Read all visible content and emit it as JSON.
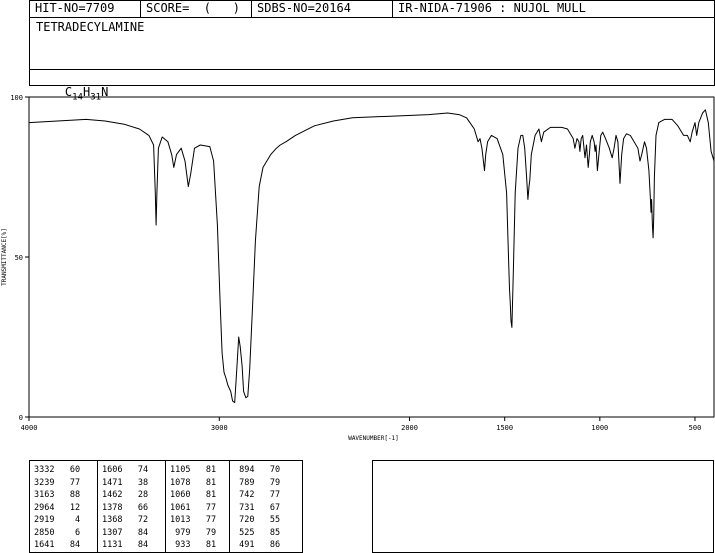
{
  "header": {
    "hit_no": "HIT-NO=7709",
    "score": "SCORE=  (   )",
    "sdbs_no": "SDBS-NO=20164",
    "ir_nida": "IR-NIDA-71906 : NUJOL MULL"
  },
  "compound": {
    "name": "TETRADECYLAMINE",
    "formula_c": "C",
    "formula_c_sub": "14",
    "formula_h": "H",
    "formula_h_sub": "31",
    "formula_n": "N"
  },
  "chart_data": {
    "type": "line",
    "xlabel": "WAVENUMBER[-1]",
    "ylabel": "TRANSMITTANCE[%]",
    "xlim": [
      4000,
      400
    ],
    "ylim": [
      0,
      100
    ],
    "x_ticks": [
      4000,
      3000,
      2000,
      1500,
      1000,
      500
    ],
    "x_tick_labels": [
      "4000",
      "3000",
      "2000",
      "1500",
      "1000",
      "500"
    ],
    "y_ticks": [
      0,
      50,
      100
    ],
    "y_tick_labels": [
      "0",
      "50",
      "100"
    ],
    "series": [
      {
        "points": [
          [
            4000,
            92
          ],
          [
            3850,
            92.5
          ],
          [
            3700,
            93
          ],
          [
            3600,
            92.5
          ],
          [
            3500,
            91.5
          ],
          [
            3420,
            90
          ],
          [
            3370,
            88
          ],
          [
            3345,
            85
          ],
          [
            3336,
            70
          ],
          [
            3332,
            60
          ],
          [
            3328,
            70
          ],
          [
            3320,
            84
          ],
          [
            3300,
            87.5
          ],
          [
            3270,
            86
          ],
          [
            3250,
            82
          ],
          [
            3239,
            78
          ],
          [
            3225,
            82
          ],
          [
            3200,
            84
          ],
          [
            3180,
            80
          ],
          [
            3163,
            72
          ],
          [
            3150,
            76
          ],
          [
            3130,
            84
          ],
          [
            3100,
            85
          ],
          [
            3050,
            84.5
          ],
          [
            3030,
            80
          ],
          [
            3010,
            60
          ],
          [
            2995,
            35
          ],
          [
            2985,
            20
          ],
          [
            2975,
            14
          ],
          [
            2964,
            12
          ],
          [
            2955,
            10
          ],
          [
            2940,
            8
          ],
          [
            2930,
            5
          ],
          [
            2919,
            4.5
          ],
          [
            2908,
            15
          ],
          [
            2898,
            25
          ],
          [
            2890,
            22
          ],
          [
            2880,
            16
          ],
          [
            2872,
            8
          ],
          [
            2860,
            6
          ],
          [
            2850,
            6.5
          ],
          [
            2840,
            15
          ],
          [
            2825,
            35
          ],
          [
            2810,
            55
          ],
          [
            2790,
            72
          ],
          [
            2770,
            78
          ],
          [
            2730,
            82
          ],
          [
            2700,
            84
          ],
          [
            2680,
            85
          ],
          [
            2650,
            86
          ],
          [
            2600,
            88
          ],
          [
            2500,
            91
          ],
          [
            2400,
            92.5
          ],
          [
            2300,
            93.5
          ],
          [
            2100,
            94
          ],
          [
            1900,
            94.5
          ],
          [
            1800,
            95
          ],
          [
            1740,
            94.5
          ],
          [
            1700,
            93.5
          ],
          [
            1660,
            90
          ],
          [
            1640,
            86
          ],
          [
            1630,
            87
          ],
          [
            1620,
            84
          ],
          [
            1612,
            80
          ],
          [
            1606,
            77
          ],
          [
            1600,
            82
          ],
          [
            1590,
            86
          ],
          [
            1570,
            88
          ],
          [
            1540,
            87
          ],
          [
            1510,
            82
          ],
          [
            1490,
            70
          ],
          [
            1480,
            50
          ],
          [
            1475,
            40
          ],
          [
            1471,
            36
          ],
          [
            1467,
            30
          ],
          [
            1462,
            28
          ],
          [
            1455,
            45
          ],
          [
            1445,
            70
          ],
          [
            1430,
            84
          ],
          [
            1415,
            88
          ],
          [
            1405,
            88
          ],
          [
            1395,
            84
          ],
          [
            1385,
            75
          ],
          [
            1378,
            68
          ],
          [
            1372,
            72
          ],
          [
            1368,
            74
          ],
          [
            1360,
            82
          ],
          [
            1340,
            88
          ],
          [
            1320,
            90
          ],
          [
            1307,
            86
          ],
          [
            1295,
            89
          ],
          [
            1260,
            90.5
          ],
          [
            1230,
            90.5
          ],
          [
            1200,
            90.5
          ],
          [
            1170,
            90
          ],
          [
            1150,
            88
          ],
          [
            1140,
            87
          ],
          [
            1131,
            84
          ],
          [
            1120,
            87
          ],
          [
            1110,
            86
          ],
          [
            1105,
            83
          ],
          [
            1098,
            87
          ],
          [
            1090,
            88
          ],
          [
            1078,
            81
          ],
          [
            1070,
            85
          ],
          [
            1061,
            78
          ],
          [
            1055,
            82
          ],
          [
            1050,
            86
          ],
          [
            1040,
            88
          ],
          [
            1030,
            86
          ],
          [
            1025,
            83
          ],
          [
            1020,
            85
          ],
          [
            1013,
            77
          ],
          [
            1005,
            82
          ],
          [
            995,
            88
          ],
          [
            985,
            89
          ],
          [
            970,
            87
          ],
          [
            950,
            84
          ],
          [
            935,
            81
          ],
          [
            925,
            84
          ],
          [
            915,
            88
          ],
          [
            905,
            86
          ],
          [
            894,
            73
          ],
          [
            885,
            82
          ],
          [
            875,
            87
          ],
          [
            860,
            88.5
          ],
          [
            840,
            88
          ],
          [
            820,
            86
          ],
          [
            800,
            84
          ],
          [
            789,
            80
          ],
          [
            780,
            82
          ],
          [
            765,
            86
          ],
          [
            755,
            84
          ],
          [
            742,
            77
          ],
          [
            736,
            70
          ],
          [
            731,
            64
          ],
          [
            728,
            68
          ],
          [
            724,
            60
          ],
          [
            720,
            56
          ],
          [
            717,
            62
          ],
          [
            713,
            75
          ],
          [
            705,
            88
          ],
          [
            690,
            92
          ],
          [
            660,
            93
          ],
          [
            620,
            93
          ],
          [
            590,
            91
          ],
          [
            560,
            88
          ],
          [
            540,
            88
          ],
          [
            525,
            86
          ],
          [
            515,
            89
          ],
          [
            500,
            92
          ],
          [
            491,
            88
          ],
          [
            480,
            92
          ],
          [
            460,
            95
          ],
          [
            445,
            96
          ],
          [
            430,
            92
          ],
          [
            415,
            83
          ],
          [
            400,
            80
          ]
        ]
      }
    ]
  },
  "peaks": {
    "columns": [
      [
        [
          "3332",
          "60"
        ],
        [
          "3239",
          "77"
        ],
        [
          "3163",
          "88"
        ],
        [
          "2964",
          "12"
        ],
        [
          "2919",
          "4"
        ],
        [
          "2850",
          "6"
        ],
        [
          "1641",
          "84"
        ]
      ],
      [
        [
          "1606",
          "74"
        ],
        [
          "1471",
          "38"
        ],
        [
          "1462",
          "28"
        ],
        [
          "1378",
          "66"
        ],
        [
          "1368",
          "72"
        ],
        [
          "1307",
          "84"
        ],
        [
          "1131",
          "84"
        ]
      ],
      [
        [
          "1105",
          "81"
        ],
        [
          "1078",
          "81"
        ],
        [
          "1060",
          "81"
        ],
        [
          "1061",
          "77"
        ],
        [
          "1013",
          "77"
        ],
        [
          "979",
          "79"
        ],
        [
          "933",
          "81"
        ]
      ],
      [
        [
          "894",
          "70"
        ],
        [
          "789",
          "79"
        ],
        [
          "742",
          "77"
        ],
        [
          "731",
          "67"
        ],
        [
          "720",
          "55"
        ],
        [
          "525",
          "85"
        ],
        [
          "491",
          "86"
        ]
      ]
    ]
  }
}
